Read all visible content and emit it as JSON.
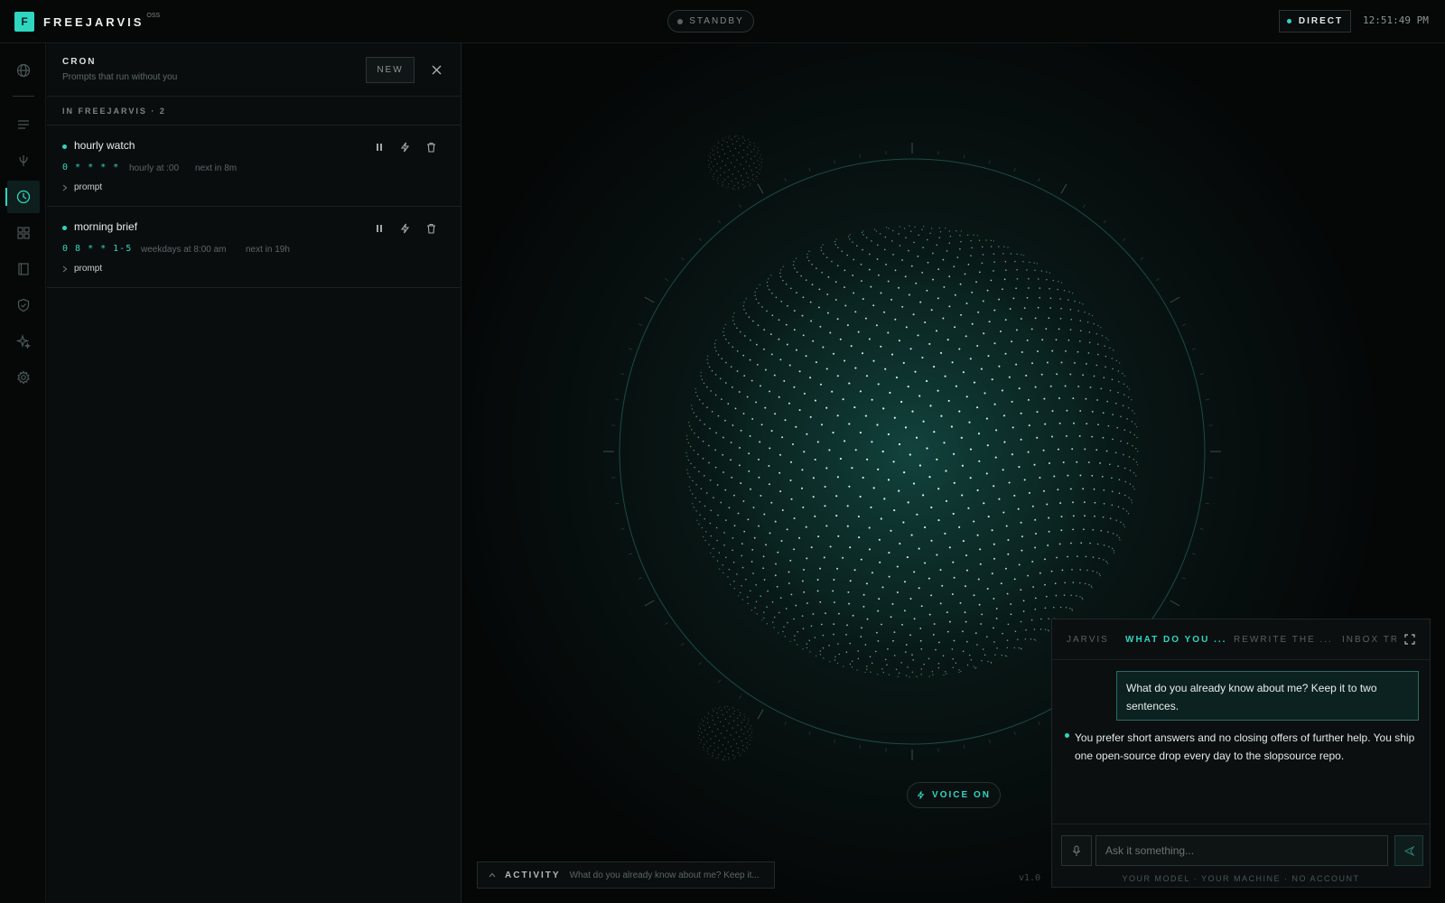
{
  "app": {
    "logo_letter": "F",
    "name": "FREEJARVIS",
    "badge": "OSS",
    "status": "STANDBY",
    "mode": "DIRECT",
    "time": "12:51:49 PM",
    "version": "v1.0"
  },
  "rail": {
    "items": [
      {
        "icon": "globe-icon"
      },
      {
        "icon": "list-icon"
      },
      {
        "icon": "split-icon"
      },
      {
        "icon": "clock-icon",
        "active": true
      },
      {
        "icon": "grid-icon"
      },
      {
        "icon": "book-icon"
      },
      {
        "icon": "shield-icon"
      },
      {
        "icon": "sparkle-icon"
      },
      {
        "icon": "gear-icon"
      }
    ]
  },
  "cron": {
    "title": "CRON",
    "subtitle": "Prompts that run without you",
    "new_label": "NEW",
    "section": "IN FREEJARVIS · 2",
    "jobs": [
      {
        "name": "hourly watch",
        "schedule": "0 * * * *",
        "description": "hourly at :00",
        "next": "next in 8m",
        "prompt_label": "prompt"
      },
      {
        "name": "morning brief",
        "schedule": "0 8 * * 1-5",
        "description": "weekdays at 8:00 am",
        "next": "next in 19h",
        "prompt_label": "prompt"
      }
    ]
  },
  "voice": {
    "label": "VOICE ON"
  },
  "activity": {
    "label": "ACTIVITY",
    "last": "What do you already know about me? Keep it..."
  },
  "chat": {
    "tabs": [
      {
        "label": "JARVIS"
      },
      {
        "label": "WHAT DO YOU ...",
        "active": true
      },
      {
        "label": "REWRITE THE ..."
      },
      {
        "label": "INBOX TRI"
      }
    ],
    "user_message": "What do you already know about me? Keep it to two sentences.",
    "assistant_message": "You prefer short answers and no closing offers of further help. You ship one open-source drop every day to the slopsource repo.",
    "input_placeholder": "Ask it something...",
    "tagline": "YOUR MODEL · YOUR MACHINE · NO ACCOUNT"
  },
  "colors": {
    "accent": "#2fd6c0",
    "background": "#050707",
    "panel": "#0a0d0e"
  }
}
